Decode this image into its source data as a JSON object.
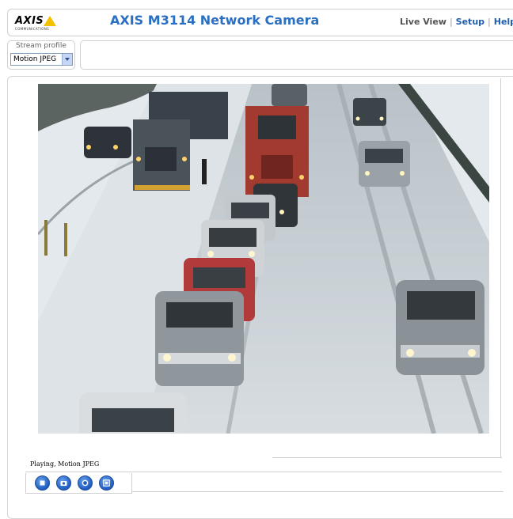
{
  "header": {
    "logo_text": "AXIS",
    "logo_sub": "COMMUNICATIONS",
    "title": "AXIS M3114 Network Camera",
    "nav": [
      {
        "label": "Live View"
      },
      {
        "label": "Setup"
      },
      {
        "label": "Help"
      }
    ]
  },
  "stream": {
    "label": "Stream profile",
    "selected": "Motion JPEG"
  },
  "status": {
    "text": "Playing, Motion JPEG"
  },
  "controls": [
    {
      "icon": "stop-icon"
    },
    {
      "icon": "snapshot-icon"
    },
    {
      "icon": "record-icon"
    },
    {
      "icon": "fullscreen-icon"
    }
  ],
  "colors": {
    "title": "#2a6fc2",
    "link": "#1e5fb3",
    "logo_triangle": "#f5c000",
    "control_button": "#1f5cc2"
  }
}
